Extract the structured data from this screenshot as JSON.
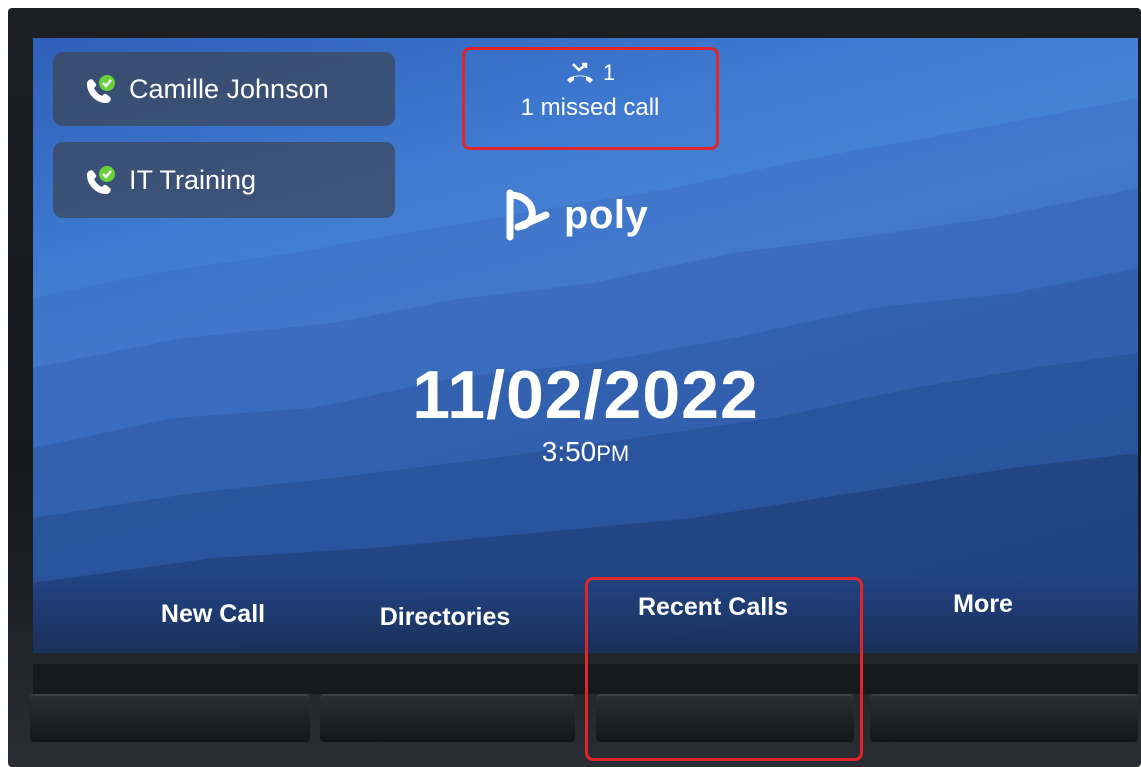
{
  "lines": [
    {
      "label": "Camille Johnson"
    },
    {
      "label": "IT Training"
    }
  ],
  "missed_call": {
    "count": "1",
    "text": "1 missed call"
  },
  "logo": {
    "word": "poly"
  },
  "clock": {
    "date": "11/02/2022",
    "time": "3:50",
    "meridiem": "PM"
  },
  "softkeys": [
    "New Call",
    "Directories",
    "Recent Calls",
    "More"
  ],
  "colors": {
    "highlight": "#e0262b",
    "presence": "#6bd13a",
    "line_key_bg": "#3c485f"
  },
  "icons": {
    "line_status": "phone-presence-icon",
    "missed_call": "missed-call-icon",
    "logo": "poly-logo-icon"
  }
}
